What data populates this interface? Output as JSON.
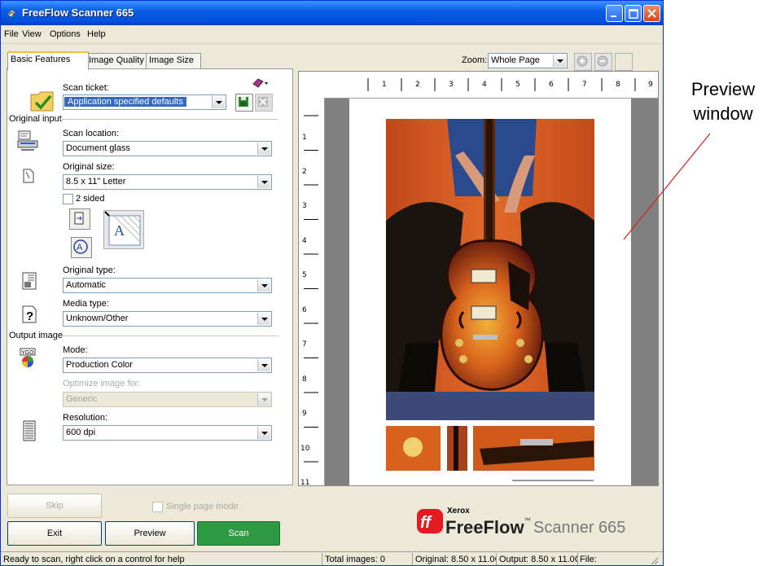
{
  "window": {
    "title": "FreeFlow Scanner 665"
  },
  "menu": [
    "File",
    "View",
    "Options",
    "Help"
  ],
  "tabs": [
    "Basic Features",
    "Image Quality",
    "Image Size"
  ],
  "scan_ticket": {
    "label": "Scan ticket:",
    "value": "Application specified defaults"
  },
  "original_input": {
    "section": "Original input",
    "scan_location": {
      "label": "Scan location:",
      "value": "Document glass"
    },
    "original_size": {
      "label": "Original size:",
      "value": "8.5 x 11\" Letter"
    },
    "two_sided": {
      "label": "2 sided",
      "checked": false
    },
    "original_type": {
      "label": "Original type:",
      "value": "Automatic"
    },
    "media_type": {
      "label": "Media type:",
      "value": "Unknown/Other"
    }
  },
  "output_image": {
    "section": "Output image",
    "mode": {
      "label": "Mode:",
      "value": "Production Color"
    },
    "optimize": {
      "label": "Optimize image for:",
      "value": "Generic"
    },
    "resolution": {
      "label": "Resolution:",
      "value": "600 dpi"
    }
  },
  "zoom": {
    "label": "Zoom:",
    "value": "Whole Page"
  },
  "ruler": {
    "h": [
      "1",
      "2",
      "3",
      "4",
      "5",
      "6",
      "7",
      "8",
      "9"
    ],
    "v": [
      "1",
      "2",
      "3",
      "4",
      "5",
      "6",
      "7",
      "8",
      "9",
      "10",
      "11"
    ]
  },
  "buttons": {
    "skip": "Skip",
    "single_page": "Single page mode",
    "exit": "Exit",
    "preview": "Preview",
    "scan": "Scan"
  },
  "brand": {
    "company": "Xerox",
    "product": "FreeFlow",
    "tm": "™",
    "model": "Scanner 665"
  },
  "status": {
    "message": "Ready to scan, right click on a control for help",
    "total": "Total images: 0",
    "original": "Original: 8.50 x 11.0C",
    "output": "Output: 8.50 x 11.0C",
    "file": "File:"
  },
  "annotation": {
    "line1": "Preview",
    "line2": "window"
  },
  "colors": {
    "title_bar": "#0a5fe6",
    "scan_button": "#2e9a43",
    "brand_red": "#e31b23",
    "selection": "#316ac5"
  }
}
